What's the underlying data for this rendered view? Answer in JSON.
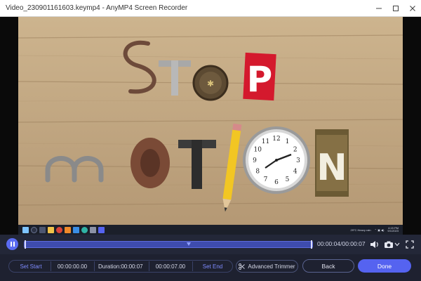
{
  "window": {
    "title": "Video_230901161603.keymp4  -  AnyMP4 Screen Recorder",
    "minimize_icon": "minimize-icon",
    "maximize_icon": "maximize-icon",
    "close_icon": "close-icon"
  },
  "video": {
    "letters_top": [
      "S",
      "T",
      "P"
    ],
    "letters_bottom": [
      "M",
      "T",
      "N"
    ],
    "clock_numbers": [
      "12",
      "1",
      "2",
      "3",
      "4",
      "5",
      "6",
      "7",
      "8",
      "9",
      "10",
      "11"
    ],
    "taskbar": {
      "weather": "29°C  Heavy rain",
      "time": "4:15 PM",
      "date": "9/1/2023"
    }
  },
  "timeline": {
    "current_time": "00:00:04",
    "total_time": "00:00:07",
    "time_separator": "/",
    "progress": 0.57
  },
  "bottombar": {
    "set_start_label": "Set Start",
    "start_time": "00:00:00.00",
    "duration_label": "Duration:",
    "duration_value": "00:00:07",
    "end_time": "00:00:07.00",
    "set_end_label": "Set End",
    "advanced_trimmer_label": "Advanced Trimmer",
    "back_label": "Back",
    "done_label": "Done"
  },
  "colors": {
    "accent": "#5563f0",
    "track": "#3e4cae",
    "panel": "#1e2130"
  }
}
